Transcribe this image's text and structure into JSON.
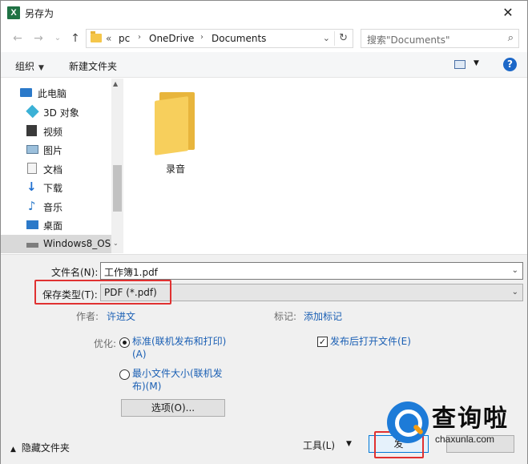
{
  "window": {
    "title": "另存为",
    "app_icon": "X",
    "close_glyph": "✕"
  },
  "nav": {
    "back_glyph": "←",
    "forward_glyph": "→",
    "recent_glyph": "⌄",
    "up_glyph": "↑",
    "address": {
      "overflow": "«",
      "segments": [
        "pc",
        "OneDrive",
        "Documents"
      ],
      "separator": "›",
      "drop_glyph": "⌄",
      "refresh_glyph": "↻"
    },
    "search": {
      "placeholder": "搜索\"Documents\"",
      "icon_glyph": "⌕"
    }
  },
  "toolbar": {
    "organize_label": "组织",
    "organize_caret": "▼",
    "new_folder_label": "新建文件夹",
    "view_caret": "▼",
    "help_glyph": "?"
  },
  "sidebar": {
    "items": [
      {
        "label": "此电脑",
        "icon": "computer-icon"
      },
      {
        "label": "3D 对象",
        "icon": "3d-objects-icon"
      },
      {
        "label": "视频",
        "icon": "video-icon"
      },
      {
        "label": "图片",
        "icon": "pictures-icon"
      },
      {
        "label": "文档",
        "icon": "documents-icon"
      },
      {
        "label": "下载",
        "icon": "downloads-icon"
      },
      {
        "label": "音乐",
        "icon": "music-icon"
      },
      {
        "label": "桌面",
        "icon": "desktop-icon"
      },
      {
        "label": "Windows8_OS",
        "icon": "drive-icon"
      }
    ],
    "scroll_up": "▲",
    "scroll_down": "⌄"
  },
  "files": [
    {
      "name": "录音",
      "icon": "folder-icon"
    }
  ],
  "form": {
    "filename_label": "文件名(N):",
    "filename_value": "工作簿1.pdf",
    "filetype_label": "保存类型(T):",
    "filetype_value": "PDF (*.pdf)",
    "author_label": "作者:",
    "author_value": "许进文",
    "tags_label": "标记:",
    "tags_value": "添加标记",
    "optimize_label": "优化:",
    "opt_standard_line1": "标准(联机发布和打印)",
    "opt_standard_line2": "(A)",
    "opt_min_line1": "最小文件大小(联机发",
    "opt_min_line2": "布)(M)",
    "open_after_label": "发布后打开文件(E)",
    "check_glyph": "✓",
    "options_button": "选项(O)...",
    "drop_glyph": "⌄"
  },
  "footer": {
    "hide_folders_label": "隐藏文件夹",
    "hide_caret": "▲",
    "tools_label": "工具(L)",
    "tools_caret": "▼",
    "publish_button": "发",
    "cancel_button": ""
  },
  "watermark": {
    "title": "查询啦",
    "subtitle": "chaxunla.com"
  },
  "colors": {
    "accent_link": "#1a5fb4",
    "highlight": "#e03131",
    "excel_green": "#1f7244"
  }
}
